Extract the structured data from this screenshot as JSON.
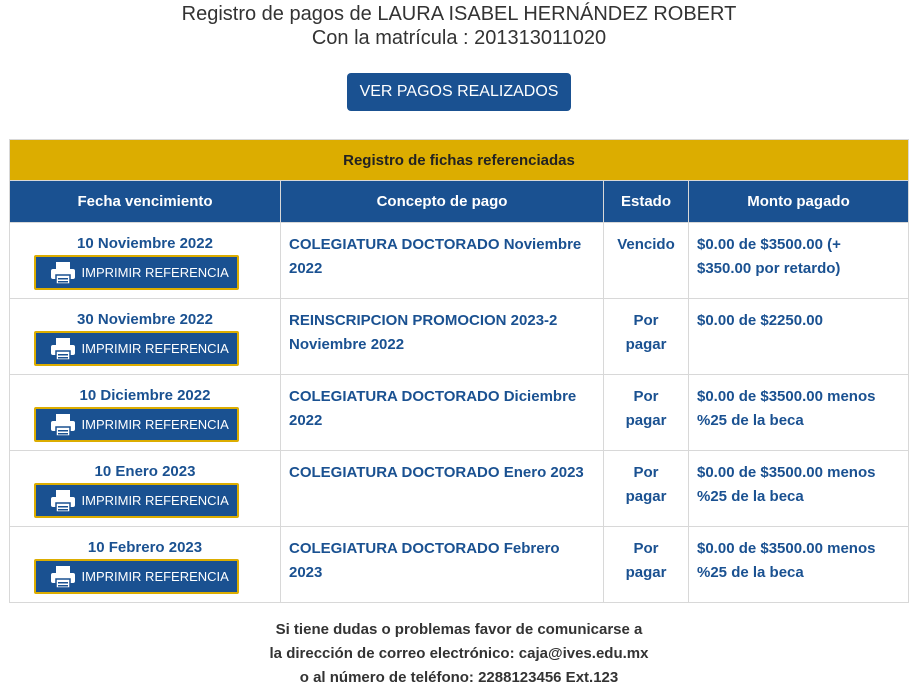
{
  "header": {
    "line1": "Registro de pagos de LAURA ISABEL HERNÁNDEZ ROBERT",
    "line2": "Con la matrícula : 201313011020"
  },
  "ver_pagos_button": "VER PAGOS REALIZADOS",
  "table": {
    "caption": "Registro de fichas referenciadas",
    "columns": [
      "Fecha vencimiento",
      "Concepto de pago",
      "Estado",
      "Monto pagado"
    ],
    "print_label": "IMPRIMIR REFERENCIA",
    "print_icon": "printer-icon",
    "rows": [
      {
        "fecha": "10 Noviembre 2022",
        "concepto": "COLEGIATURA DOCTORADO Noviembre 2022",
        "estado": "Vencido",
        "monto": "$0.00 de $3500.00 (+ $350.00 por retardo)"
      },
      {
        "fecha": "30 Noviembre 2022",
        "concepto": "REINSCRIPCION PROMOCION 2023-2 Noviembre 2022",
        "estado": "Por pagar",
        "monto": "$0.00 de $2250.00"
      },
      {
        "fecha": "10 Diciembre 2022",
        "concepto": "COLEGIATURA DOCTORADO Diciembre 2022",
        "estado": "Por pagar",
        "monto": "$0.00 de $3500.00 menos %25 de la beca"
      },
      {
        "fecha": "10 Enero 2023",
        "concepto": "COLEGIATURA DOCTORADO Enero 2023",
        "estado": "Por pagar",
        "monto": "$0.00 de $3500.00 menos %25 de la beca"
      },
      {
        "fecha": "10 Febrero 2023",
        "concepto": "COLEGIATURA DOCTORADO Febrero 2023",
        "estado": "Por pagar",
        "monto": "$0.00 de $3500.00 menos %25 de la beca"
      }
    ]
  },
  "footer": {
    "line1": "Si tiene dudas o problemas favor de comunicarse a",
    "line2": "la dirección de correo electrónico: caja@ives.edu.mx",
    "line3": "o al número de teléfono: 2288123456 Ext.123"
  },
  "colors": {
    "primary": "#1a5191",
    "accent": "#dcad00",
    "vencido": "#e0141e"
  }
}
